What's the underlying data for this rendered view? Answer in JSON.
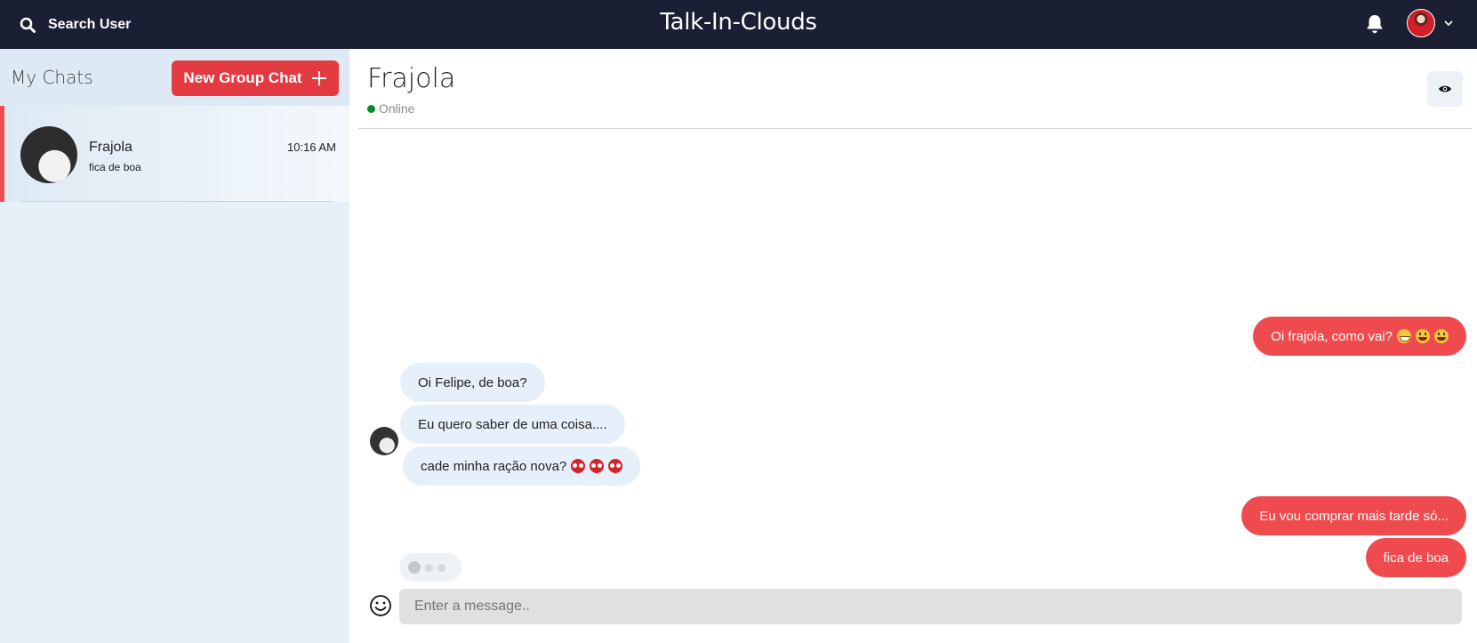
{
  "header": {
    "search_label": "Search User",
    "app_title": "Talk-In-Clouds",
    "brand_color": "#1a1f33"
  },
  "sidebar": {
    "title": "My Chats",
    "new_group_label": "New Group Chat",
    "chats": [
      {
        "name": "Frajola",
        "time": "10:16 AM",
        "last_message": "fica de boa",
        "selected": true
      }
    ]
  },
  "chat": {
    "contact_name": "Frajola",
    "status": "Online",
    "accent_color": "#ef4b4f",
    "messages": [
      {
        "direction": "out",
        "text": "Oi frajola, como vai?",
        "emojis": [
          "grin",
          "smile",
          "smile"
        ]
      },
      {
        "direction": "in",
        "text": "Oi Felipe, de boa?",
        "emojis": []
      },
      {
        "direction": "in",
        "text": "Eu quero saber de uma coisa....",
        "emojis": []
      },
      {
        "direction": "in",
        "text": "cade minha ração nova?",
        "emojis": [
          "eyes",
          "eyes",
          "eyes"
        ]
      },
      {
        "direction": "out",
        "text": "Eu vou comprar mais tarde só...",
        "emojis": []
      },
      {
        "direction": "out",
        "text": "fica de boa",
        "emojis": []
      }
    ],
    "input_placeholder": "Enter a message..",
    "input_value": ""
  }
}
